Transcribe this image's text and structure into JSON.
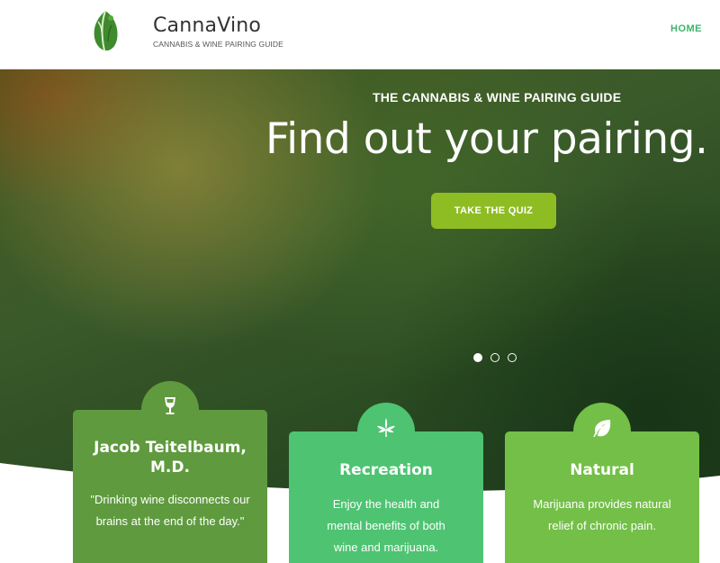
{
  "header": {
    "brand_name": "CannaVino",
    "brand_tagline": "CANNABIS & WINE PAIRING GUIDE",
    "nav": {
      "home_label": "HOME"
    }
  },
  "hero": {
    "kicker": "THE CANNABIS & WINE PAIRING GUIDE",
    "title": "Find out your pairing.",
    "cta_label": "TAKE THE QUIZ",
    "slides": {
      "count": 3,
      "active": 1
    }
  },
  "cards": [
    {
      "title": "Jacob Teitelbaum, M.D.",
      "text": "\"Drinking wine disconnects our brains at the end of the day.\"",
      "icon": "wine-glass-icon"
    },
    {
      "title": "Recreation",
      "text": "Enjoy the health and mental benefits of both wine and marijuana.",
      "icon": "cannabis-leaf-icon"
    },
    {
      "title": "Natural",
      "text": "Marijuana provides natural relief of chronic pain.",
      "icon": "leaf-icon"
    }
  ],
  "colors": {
    "accent_green": "#3cb46c",
    "button_lime": "#8ebd23",
    "card1": "#5f9a3f",
    "card2": "#4ec372",
    "card3": "#73bf48"
  }
}
